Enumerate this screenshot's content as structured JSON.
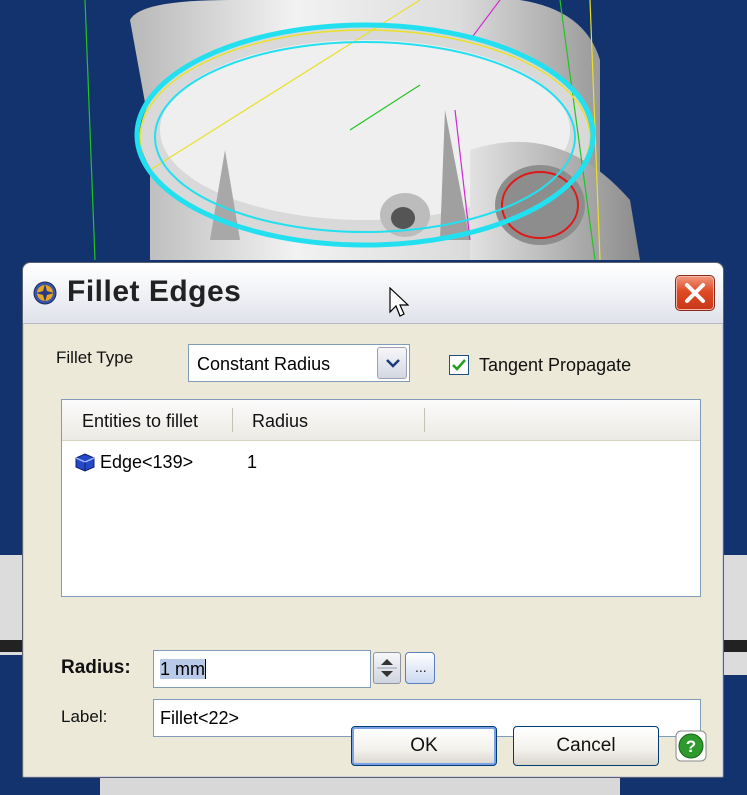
{
  "dialog": {
    "title": "Fillet Edges",
    "fillet_type_label": "Fillet Type",
    "fillet_type_value": "Constant Radius",
    "tangent_propagate_label": "Tangent Propagate",
    "tangent_propagate_checked": true,
    "list": {
      "columns": [
        "Entities to fillet",
        "Radius"
      ],
      "rows": [
        {
          "entity": "Edge<139>",
          "radius": "1"
        }
      ]
    },
    "radius_label": "Radius:",
    "radius_value": "1 mm",
    "ellipsis_label": "...",
    "label_label": "Label:",
    "label_value": "Fillet<22>",
    "ok_label": "OK",
    "cancel_label": "Cancel"
  },
  "icons": {
    "app": "compass-icon",
    "close": "close-icon",
    "dropdown": "chevron-down-icon",
    "edge": "edge-entity-icon",
    "spinner": "spinner-arrows-icon",
    "help": "help-icon",
    "cursor": "mouse-cursor-icon"
  },
  "colors": {
    "viewport_bg": "#12336e",
    "selection_highlight": "#23e0f0",
    "close_button": "#d8452a",
    "help_button": "#2e9a2e",
    "checkbox_check": "#21a121"
  }
}
